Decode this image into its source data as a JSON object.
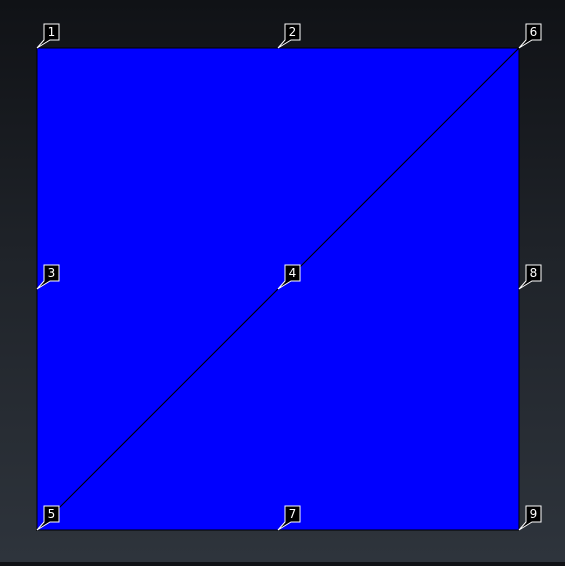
{
  "colors": {
    "element_fill": "#0000ff",
    "element_edge": "#000000",
    "label_box_fill": "#000000",
    "label_box_edge": "#ffffff",
    "label_text": "#ffffff"
  },
  "nodes": [
    {
      "id": "1"
    },
    {
      "id": "2"
    },
    {
      "id": "3"
    },
    {
      "id": "4"
    },
    {
      "id": "5"
    },
    {
      "id": "6"
    },
    {
      "id": "7"
    },
    {
      "id": "8"
    },
    {
      "id": "9"
    }
  ],
  "elements": [
    {
      "nodes": [
        "1",
        "6",
        "5"
      ]
    },
    {
      "nodes": [
        "6",
        "9",
        "5"
      ]
    }
  ]
}
